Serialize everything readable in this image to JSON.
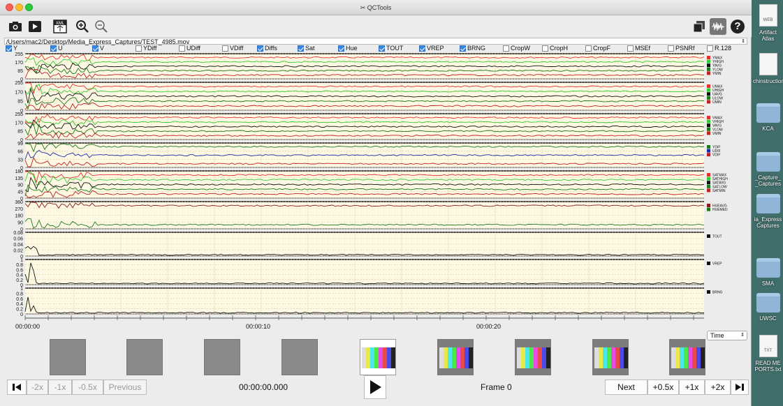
{
  "window": {
    "title": "QCTools",
    "title_icon": "film-icon"
  },
  "toolbar": {
    "icons": [
      "camera-icon",
      "export-icon",
      "xml-icon",
      "zoom-in-icon",
      "zoom-out-icon"
    ],
    "right_icons": [
      "windows-icon",
      "waveform-icon",
      "help-icon"
    ],
    "xml_label": "XML",
    "help_label": "?"
  },
  "file": {
    "path": "/Users/mac2/Desktop/Media_Express_Captures/TEST_4985.mov"
  },
  "filters": [
    {
      "label": "Y",
      "checked": true
    },
    {
      "label": "U",
      "checked": true
    },
    {
      "label": "V",
      "checked": true
    },
    {
      "label": "YDiff",
      "checked": false
    },
    {
      "label": "UDiff",
      "checked": false
    },
    {
      "label": "VDiff",
      "checked": false
    },
    {
      "label": "Diffs",
      "checked": true
    },
    {
      "label": "Sat",
      "checked": true
    },
    {
      "label": "Hue",
      "checked": true
    },
    {
      "label": "TOUT",
      "checked": true
    },
    {
      "label": "VREP",
      "checked": true
    },
    {
      "label": "BRNG",
      "checked": true
    },
    {
      "label": "CropW",
      "checked": false
    },
    {
      "label": "CropH",
      "checked": false
    },
    {
      "label": "CropF",
      "checked": false
    },
    {
      "label": "MSEf",
      "checked": false
    },
    {
      "label": "PSNRf",
      "checked": false
    },
    {
      "label": "R.128",
      "checked": false
    }
  ],
  "chart_data": [
    {
      "type": "line",
      "ticks": [
        "255",
        "170",
        "85",
        "0"
      ],
      "ylim": [
        0,
        255
      ],
      "series": [
        {
          "name": "YMAX",
          "color": "#e53030"
        },
        {
          "name": "YHIGH",
          "color": "#33cc33"
        },
        {
          "name": "YAVG",
          "color": "#111111"
        },
        {
          "name": "YLOW",
          "color": "#1a7a1a"
        },
        {
          "name": "YMIN",
          "color": "#c02020"
        }
      ]
    },
    {
      "type": "line",
      "ticks": [
        "255",
        "170",
        "85",
        "0"
      ],
      "ylim": [
        0,
        255
      ],
      "series": [
        {
          "name": "UMAX",
          "color": "#e53030"
        },
        {
          "name": "UHIGH",
          "color": "#33cc33"
        },
        {
          "name": "UAVG",
          "color": "#111111"
        },
        {
          "name": "ULOW",
          "color": "#1a7a1a"
        },
        {
          "name": "UMIN",
          "color": "#c02020"
        }
      ]
    },
    {
      "type": "line",
      "ticks": [
        "255",
        "170",
        "85",
        "0"
      ],
      "ylim": [
        0,
        255
      ],
      "series": [
        {
          "name": "VMAX",
          "color": "#e53030"
        },
        {
          "name": "VHIGH",
          "color": "#33cc33"
        },
        {
          "name": "VAVG",
          "color": "#111111"
        },
        {
          "name": "VLOW",
          "color": "#1a7a1a"
        },
        {
          "name": "VMIN",
          "color": "#c02020"
        }
      ]
    },
    {
      "type": "line",
      "ticks": [
        "99",
        "66",
        "33",
        "0"
      ],
      "ylim": [
        0,
        99
      ],
      "series": [
        {
          "name": "YDIF",
          "color": "#1a7a1a"
        },
        {
          "name": "UDIF",
          "color": "#1a2aa0"
        },
        {
          "name": "VDIF",
          "color": "#c02020"
        }
      ]
    },
    {
      "type": "line",
      "ticks": [
        "180",
        "135",
        "90",
        "45",
        "0"
      ],
      "ylim": [
        0,
        180
      ],
      "series": [
        {
          "name": "SATMAX",
          "color": "#e53030"
        },
        {
          "name": "SATHIGH",
          "color": "#33cc33"
        },
        {
          "name": "SATAVG",
          "color": "#111111"
        },
        {
          "name": "SATLOW",
          "color": "#1a7a1a"
        },
        {
          "name": "SATMIN",
          "color": "#c02020"
        }
      ]
    },
    {
      "type": "line",
      "ticks": [
        "360",
        "270",
        "180",
        "90",
        "0"
      ],
      "ylim": [
        0,
        360
      ],
      "series": [
        {
          "name": "HUEAVG",
          "color": "#8b1a1a"
        },
        {
          "name": "HUEMED",
          "color": "#1a7a1a"
        }
      ]
    },
    {
      "type": "line",
      "ticks": [
        "0.08",
        "0.06",
        "0.04",
        "0.02",
        "0"
      ],
      "ylim": [
        0,
        0.08
      ],
      "series": [
        {
          "name": "TOUT",
          "color": "#111111"
        }
      ]
    },
    {
      "type": "line",
      "ticks": [
        "1",
        "0.8",
        "0.6",
        "0.4",
        "0.2",
        "0"
      ],
      "ylim": [
        0,
        1
      ],
      "series": [
        {
          "name": "VREP",
          "color": "#111111"
        }
      ]
    },
    {
      "type": "line",
      "ticks": [
        "1",
        "0.8",
        "0.6",
        "0.4",
        "0.2",
        "0"
      ],
      "ylim": [
        0,
        1
      ],
      "series": [
        {
          "name": "BRNG",
          "color": "#111111"
        }
      ]
    }
  ],
  "timeline": {
    "labels": [
      "00:00:00",
      "00:00:10",
      "00:00:20"
    ]
  },
  "time_select": {
    "value": "Time"
  },
  "thumbnails": [
    "gray",
    "gray",
    "gray",
    "gray",
    "bars",
    "bars",
    "bars",
    "bars",
    "bars"
  ],
  "controls": {
    "minus2x": "-2x",
    "minus1x": "-1x",
    "minus05x": "-0.5x",
    "previous": "Previous",
    "timecode": "00:00:00.000",
    "frame": "Frame 0",
    "next": "Next",
    "plus05x": "+0.5x",
    "plus1x": "+1x",
    "plus2x": "+2x"
  },
  "desktop": [
    {
      "label": "Artifact Atlas",
      "kind": "doc",
      "badge": "WEB"
    },
    {
      "label": "chinstructions",
      "kind": "doc",
      "badge": ""
    },
    {
      "label": "KCA",
      "kind": "folder"
    },
    {
      "label": "_Capture_ _Captures",
      "kind": "folder"
    },
    {
      "label": "ia_Express Captures",
      "kind": "folder"
    },
    {
      "label": "SMA",
      "kind": "folder"
    },
    {
      "label": "UWSC",
      "kind": "folder"
    },
    {
      "label": "READ ME PORTS.txt",
      "kind": "doc",
      "badge": "TXT"
    }
  ]
}
